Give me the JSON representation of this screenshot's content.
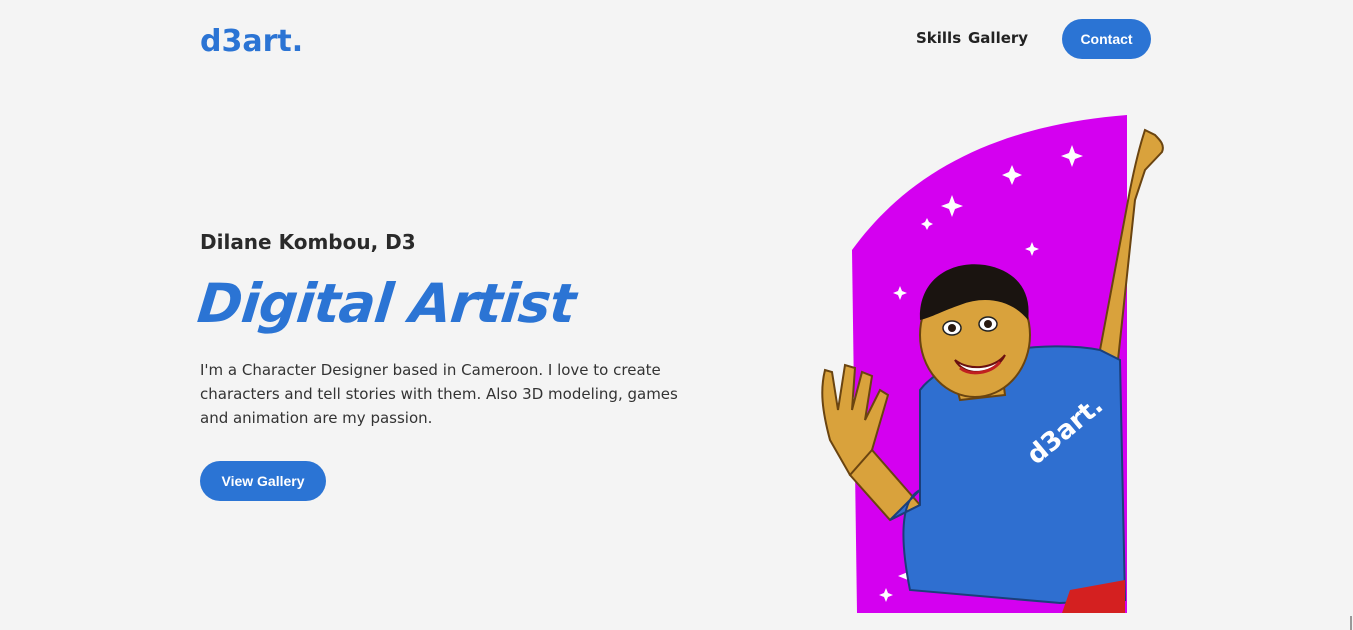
{
  "header": {
    "logo_text": "d3art.",
    "nav": {
      "skills": "Skills",
      "gallery": "Gallery",
      "contact": "Contact"
    }
  },
  "hero": {
    "name": "Dilane Kombou, D3",
    "title": "Digital Artist",
    "description": "I'm a Character Designer based in Cameroon. I love to create characters and tell stories with them. Also 3D modeling, games and animation are my passion.",
    "cta": "View Gallery",
    "shirt_logo": "d3art."
  },
  "colors": {
    "brand_blue": "#2b74d4",
    "magenta": "#d400f0",
    "background": "#f4f4f4",
    "skin": "#d9a23c"
  }
}
